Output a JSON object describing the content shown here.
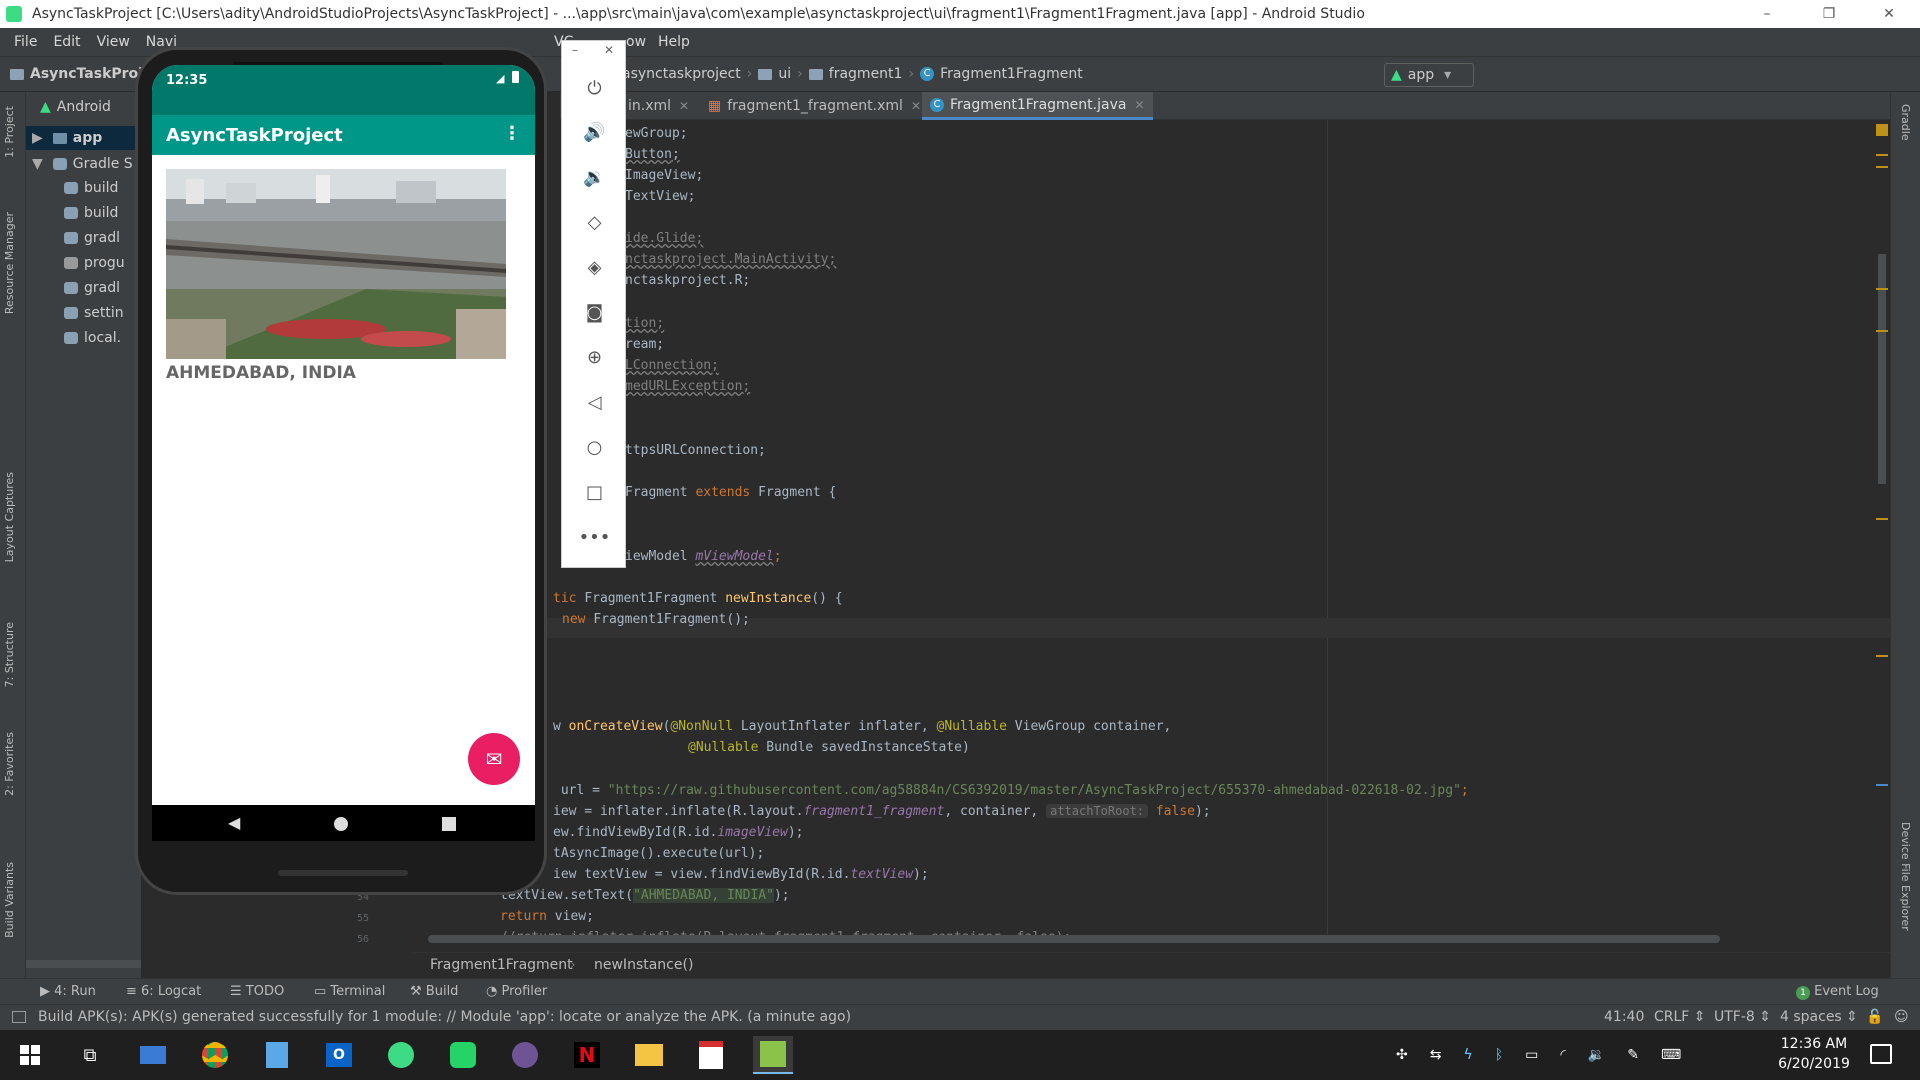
{
  "window": {
    "title": "AsyncTaskProject [C:\\Users\\adity\\AndroidStudioProjects\\AsyncTaskProject] - ...\\app\\src\\main\\java\\com\\example\\asynctaskproject\\ui\\fragment1\\Fragment1Fragment.java [app] - Android Studio",
    "minimize": "–",
    "restore": "❐",
    "close": "✕"
  },
  "menu": [
    "File",
    "Edit",
    "View",
    "Navi",
    "VC",
    "ow",
    "Help"
  ],
  "navbar": {
    "project": "AsyncTaskProj",
    "crumbs": [
      "asynctaskproject",
      "ui",
      "fragment1",
      "Fragment1Fragment"
    ],
    "run_config": "app"
  },
  "tabs": [
    {
      "label": "in.xml"
    },
    {
      "label": "fragment1_fragment.xml"
    },
    {
      "label": "Fragment1Fragment.java",
      "active": true
    }
  ],
  "project_panel": {
    "view": "Android",
    "items": [
      "app",
      "Gradle S",
      "build",
      "build",
      "gradl",
      "progu",
      "gradl",
      "settin",
      "local."
    ]
  },
  "left_tabs": [
    "1: Project",
    "Resource Manager",
    "Layout Captures",
    "7: Structure",
    "2: Favorites",
    "Build Variants"
  ],
  "right_tabs": [
    "Gradle",
    "Device File Explorer"
  ],
  "code": {
    "l1": "ewGroup;",
    "l2": "Button;",
    "l3": "ImageView;",
    "l4": "TextView;",
    "l5": "ide.Glide;",
    "l6": "nctaskproject.MainActivity;",
    "l7": "nctaskproject.R;",
    "l8": "tion;",
    "l9": "ream;",
    "l10": "LConnection;",
    "l11": "medURLException;",
    "l12": "ttpsURLConnection;",
    "l13a": "Fragment ",
    "l13b": "extends",
    "l13c": " Fragment {",
    "l14a": "iewModel ",
    "l14b": "mViewModel",
    "l14c": ";",
    "l15a": "tic ",
    "l15b": "Fragment1Fragment ",
    "l15c": "newInstance",
    "l15d": "() {",
    "l16a": "new ",
    "l16b": "Fragment1Fragment();",
    "l17a": "w ",
    "l17b": "onCreateView",
    "l17c": "(",
    "l17d": "@NonNull",
    "l17e": " LayoutInflater inflater, ",
    "l17f": "@Nullable",
    "l17g": " ViewGroup container,",
    "l18a": "@Nullable",
    "l18b": " Bundle savedInstanceState)",
    "l19a": " url = ",
    "l19b": "\"https://raw.githubusercontent.com/ag58884n/CS6392019/master/AsyncTaskProject/655370-ahmedabad-022618-02.jpg\"",
    "l19c": ";",
    "l20a": "iew = inflater.inflate(R.layout.",
    "l20b": "fragment1_fragment",
    "l20c": ", container, ",
    "l20d": "attachToRoot:",
    "l20e": " false",
    "l20f": ");",
    "l21a": "ew.findViewById(R.id.",
    "l21b": "imageView",
    "l21c": ");",
    "l22": "tAsyncImage().execute(url);",
    "l23a": "iew textView = view.findViewById(R.id.",
    "l23b": "textView",
    "l23c": ");",
    "l24a": "textView.setText(",
    "l24b": "\"AHMEDABAD, INDIA\"",
    "l24c": ");",
    "l25a": "return",
    "l25b": " view;",
    "l26": "//return inflater.inflate(R.layout.fragment1_fragment, container, false);",
    "ln54": "54",
    "ln55": "55",
    "ln56": "56"
  },
  "breadcrumb_bottom": [
    "Fragment1Fragment",
    "newInstance()"
  ],
  "phone": {
    "time": "12:35",
    "app_title": "AsyncTaskProject",
    "caption": "AHMEDABAD, INDIA",
    "fab_icon": "email-icon"
  },
  "emulator_controls": [
    "power-icon",
    "volume-up-icon",
    "volume-down-icon",
    "rotate-left-icon",
    "rotate-right-icon",
    "camera-icon",
    "zoom-icon",
    "back-icon",
    "home-icon",
    "overview-icon",
    "more-icon"
  ],
  "toolwindows": [
    "4: Run",
    "6: Logcat",
    "TODO",
    "Terminal",
    "Build",
    "Profiler"
  ],
  "event_log": "Event Log",
  "status": {
    "message": "Build APK(s): APK(s) generated successfully for 1 module: // Module 'app': locate or analyze the APK. (a minute ago)",
    "position": "41:40",
    "line_sep": "CRLF",
    "encoding": "UTF-8",
    "indent": "4 spaces"
  },
  "taskbar": {
    "time": "12:36 AM",
    "date": "6/20/2019"
  },
  "colors": {
    "editor_bg": "#2b2b2b",
    "panel_bg": "#3c3f41",
    "app_primary": "#009688",
    "app_primary_dark": "#00796b",
    "fab": "#e91e63"
  }
}
